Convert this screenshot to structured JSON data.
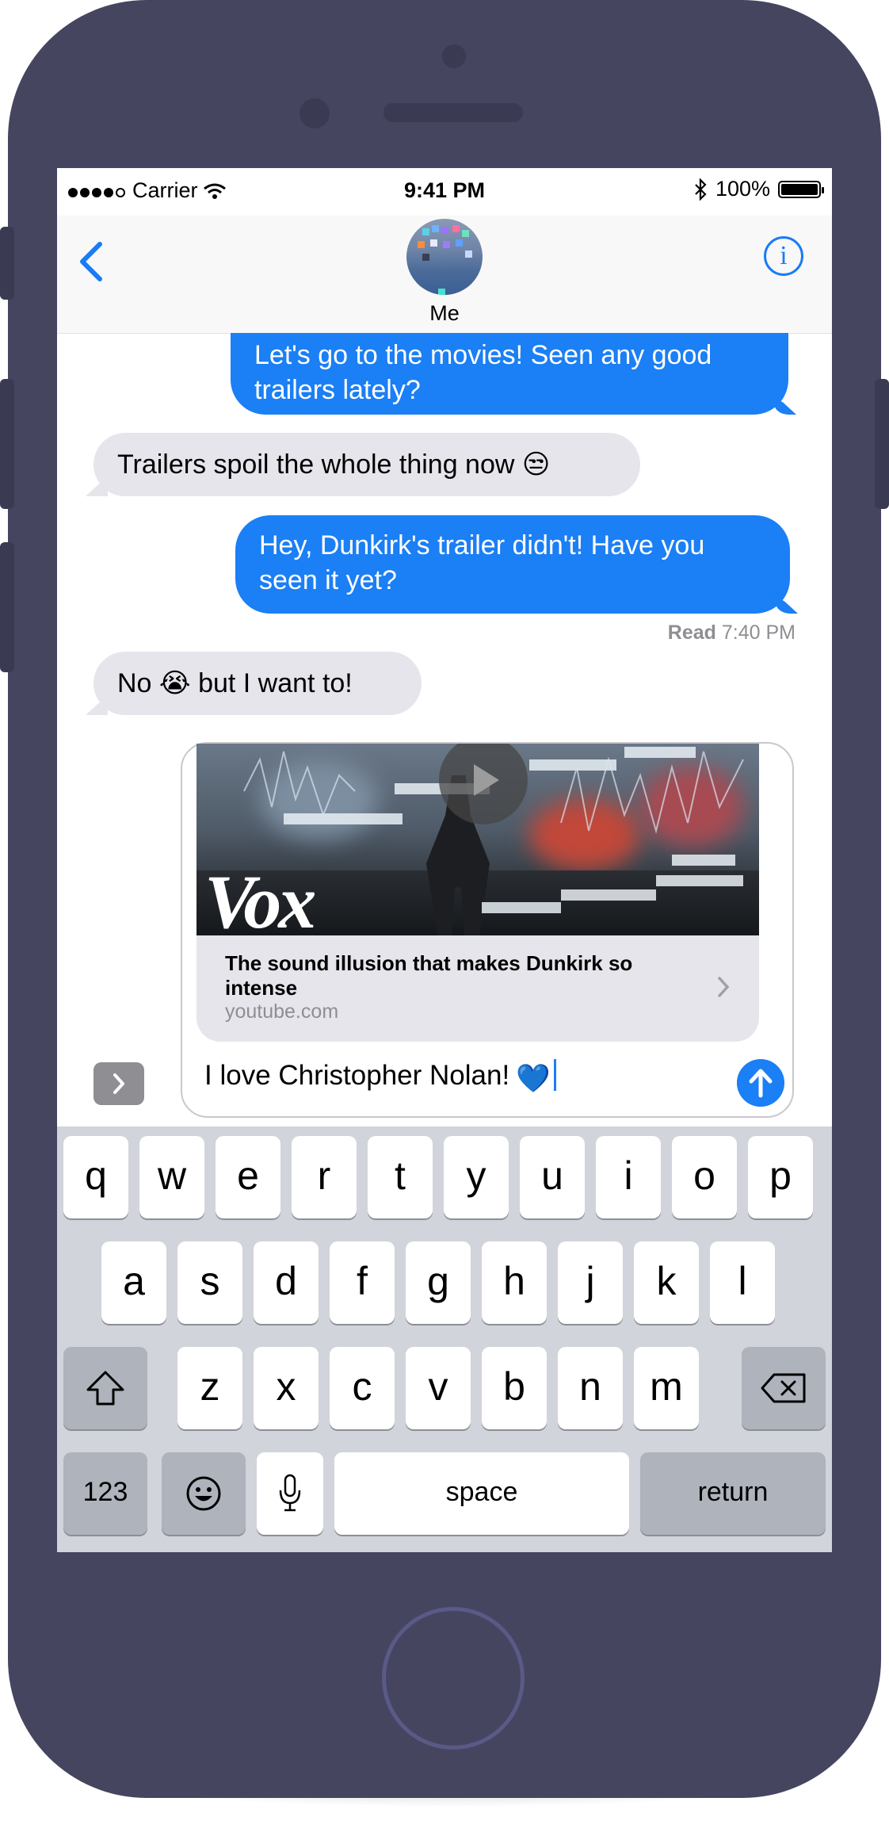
{
  "status_bar": {
    "carrier": "Carrier",
    "time": "9:41 PM",
    "battery": "100%"
  },
  "nav": {
    "contact_name": "Me",
    "info_label": "i"
  },
  "messages": [
    {
      "from": "me",
      "text": "Let's go to the movies! Seen any good trailers lately?",
      "lines": [
        "Let's go to the movies! Seen any good",
        "trailers lately?"
      ]
    },
    {
      "from": "them",
      "text": "Trailers spoil the whole thing now 😒"
    },
    {
      "from": "me",
      "text": "Hey, Dunkirk's trailer didn't! Have you seen it yet?",
      "lines": [
        "Hey, Dunkirk's trailer didn't! Have you",
        "seen it yet?"
      ]
    },
    {
      "from": "them",
      "text": "No 😭 but I want to!"
    }
  ],
  "receipt": {
    "label": "Read",
    "time": "7:40 PM"
  },
  "link_preview": {
    "brand": "Vox",
    "title": "The sound illusion that makes Dunkirk so intense",
    "domain": "youtube.com"
  },
  "compose": {
    "text": "I love Christopher Nolan!",
    "emoji": "💙"
  },
  "keyboard": {
    "row1": [
      "q",
      "w",
      "e",
      "r",
      "t",
      "y",
      "u",
      "i",
      "o",
      "p"
    ],
    "row2": [
      "a",
      "s",
      "d",
      "f",
      "g",
      "h",
      "j",
      "k",
      "l"
    ],
    "row3": [
      "z",
      "x",
      "c",
      "v",
      "b",
      "n",
      "m"
    ],
    "numbers_label": "123",
    "space_label": "space",
    "return_label": "return"
  },
  "colors": {
    "phone_frame": "#454560",
    "accent_blue": "#1b7ff5",
    "incoming_bubble": "#e6e5eb",
    "keyboard_bg": "#d1d4da"
  }
}
